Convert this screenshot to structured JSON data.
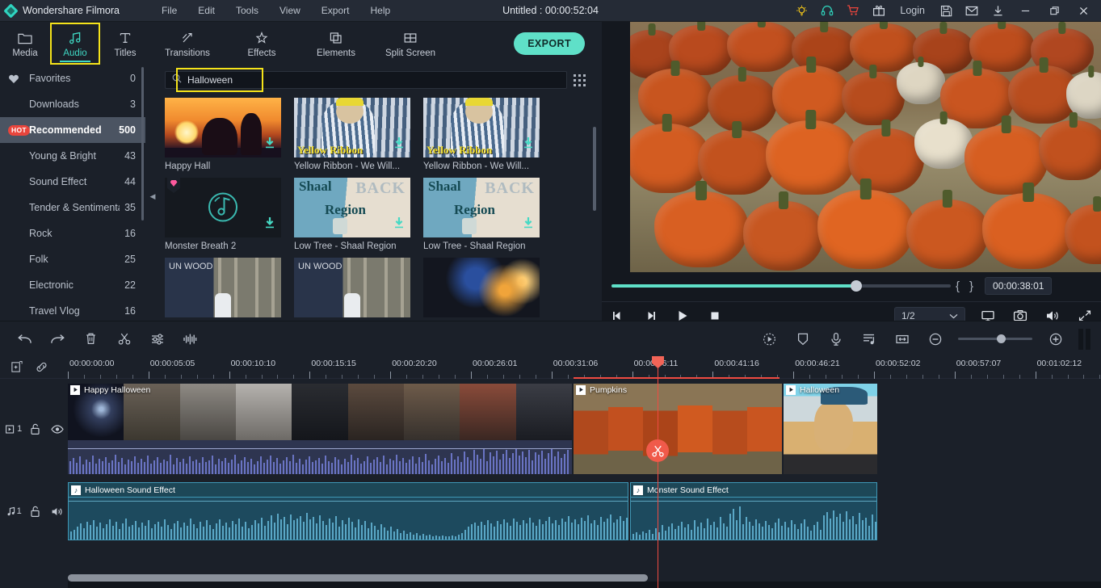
{
  "titlebar": {
    "app_name": "Wondershare Filmora",
    "menus": [
      "File",
      "Edit",
      "Tools",
      "View",
      "Export",
      "Help"
    ],
    "project_title": "Untitled : 00:00:52:04",
    "login_label": "Login",
    "icons": [
      "bulb-icon",
      "headset-icon",
      "cart-icon",
      "gift-icon",
      "save-icon",
      "mail-icon",
      "download-icon"
    ],
    "window_controls": [
      "minimize-icon",
      "maximize-icon",
      "close-icon"
    ]
  },
  "tabs": {
    "items": [
      {
        "label": "Media",
        "icon": "folder-icon",
        "active": false
      },
      {
        "label": "Audio",
        "icon": "music-note-icon",
        "active": true
      },
      {
        "label": "Titles",
        "icon": "text-t-icon",
        "active": false
      },
      {
        "label": "Transitions",
        "icon": "transition-arrows-icon",
        "active": false
      },
      {
        "label": "Effects",
        "icon": "magic-star-icon",
        "active": false
      },
      {
        "label": "Elements",
        "icon": "layers-icon",
        "active": false
      },
      {
        "label": "Split Screen",
        "icon": "split-screen-icon",
        "active": false
      }
    ],
    "export_label": "EXPORT"
  },
  "sidebar": {
    "items": [
      {
        "label": "Favorites",
        "count": "0",
        "icon": "heart-icon",
        "badge": "",
        "selected": false
      },
      {
        "label": "Downloads",
        "count": "3",
        "icon": "",
        "badge": "",
        "selected": false
      },
      {
        "label": "Recommended",
        "count": "500",
        "icon": "",
        "badge": "HOT",
        "selected": true
      },
      {
        "label": "Young & Bright",
        "count": "43",
        "icon": "",
        "badge": "",
        "selected": false
      },
      {
        "label": "Sound Effect",
        "count": "44",
        "icon": "",
        "badge": "",
        "selected": false
      },
      {
        "label": "Tender & Sentimental",
        "count": "35",
        "icon": "",
        "badge": "",
        "selected": false
      },
      {
        "label": "Rock",
        "count": "16",
        "icon": "",
        "badge": "",
        "selected": false
      },
      {
        "label": "Folk",
        "count": "25",
        "icon": "",
        "badge": "",
        "selected": false
      },
      {
        "label": "Electronic",
        "count": "22",
        "icon": "",
        "badge": "",
        "selected": false
      },
      {
        "label": "Travel Vlog",
        "count": "16",
        "icon": "",
        "badge": "",
        "selected": false
      }
    ]
  },
  "library": {
    "search": {
      "value": "Halloween",
      "placeholder": "Search",
      "icon": "search-icon"
    },
    "view_toggle_icon": "grid-view-icon",
    "items": [
      {
        "title": "Happy Hall",
        "art": "sunset",
        "premium": false,
        "download": true,
        "overlay": ""
      },
      {
        "title": "Yellow Ribbon - We Will...",
        "art": "ribbon",
        "premium": false,
        "download": true,
        "overlay": "Yellow Ribbon"
      },
      {
        "title": "Yellow Ribbon - We Will...",
        "art": "ribbon",
        "premium": false,
        "download": true,
        "overlay": "Yellow Ribbon"
      },
      {
        "title": "Monster Breath 2",
        "art": "disc",
        "premium": true,
        "download": true,
        "overlay": ""
      },
      {
        "title": "Low Tree - Shaal Region",
        "art": "shaal",
        "premium": false,
        "download": true,
        "overlay": "Shaal Region"
      },
      {
        "title": "Low Tree - Shaal Region",
        "art": "shaal",
        "premium": false,
        "download": true,
        "overlay": "Shaal Region"
      },
      {
        "title": "",
        "art": "wood",
        "premium": false,
        "download": false,
        "overlay": "UN WOOD"
      },
      {
        "title": "",
        "art": "wood",
        "premium": false,
        "download": false,
        "overlay": "UN WOOD"
      },
      {
        "title": "",
        "art": "bokeh",
        "premium": false,
        "download": false,
        "overlay": ""
      }
    ]
  },
  "preview": {
    "timecode": "00:00:38:01",
    "mark_in": "{",
    "mark_out": "}",
    "progress_percent": 72,
    "controls": [
      "prev-frame-icon",
      "next-frame-icon",
      "play-icon",
      "stop-icon"
    ],
    "ratio_value": "1/2",
    "right_icons": [
      "screen-cast-icon",
      "snapshot-camera-icon",
      "volume-icon",
      "fullscreen-icon"
    ]
  },
  "edit_toolbar": {
    "left_icons": [
      "undo-icon",
      "redo-icon",
      "delete-trash-icon",
      "split-scissors-icon",
      "adjust-sliders-icon",
      "audio-waveform-icon"
    ],
    "right_icons": [
      "color-effect-icon",
      "crop-shield-icon",
      "voiceover-mic-icon",
      "audio-mixer-icon",
      "fit-timeline-icon",
      "zoom-out-icon",
      "zoom-in-icon",
      "marker-icon"
    ],
    "zoom_percent": 52
  },
  "timeline": {
    "header_icons": [
      "add-marker-icon",
      "link-chain-icon"
    ],
    "ruler_labels": [
      "00:00:00:00",
      "00:00:05:05",
      "00:00:10:10",
      "00:00:15:15",
      "00:00:20:20",
      "00:00:26:01",
      "00:00:31:06",
      "00:00:36:11",
      "00:00:41:16",
      "00:00:46:21",
      "00:00:52:02",
      "00:00:57:07",
      "00:01:02:12"
    ],
    "playhead_time": "00:00:36:11",
    "video_track": {
      "name": "1",
      "icon": "video-track-icon",
      "lock_icon": "unlock-icon",
      "eye_icon": "eye-visible-icon",
      "clips": [
        {
          "label": "Happy Halloween",
          "selected": false
        },
        {
          "label": "Pumpkins",
          "selected": true
        },
        {
          "label": "Halloween",
          "selected": false
        }
      ]
    },
    "audio_track": {
      "name": "1",
      "icon": "audio-track-icon",
      "lock_icon": "unlock-icon",
      "mute_icon": "speaker-icon",
      "clips": [
        {
          "label": "Halloween Sound Effect"
        },
        {
          "label": "Monster Sound Effect"
        }
      ]
    }
  },
  "colors": {
    "accent_teal": "#5fe0c8",
    "highlight_yellow": "#f5e31a",
    "playhead_red": "#ef4b42",
    "selection_blue": "#4f6ede",
    "audio_clip": "#1d4a5e",
    "panel_bg": "#1b2029"
  }
}
